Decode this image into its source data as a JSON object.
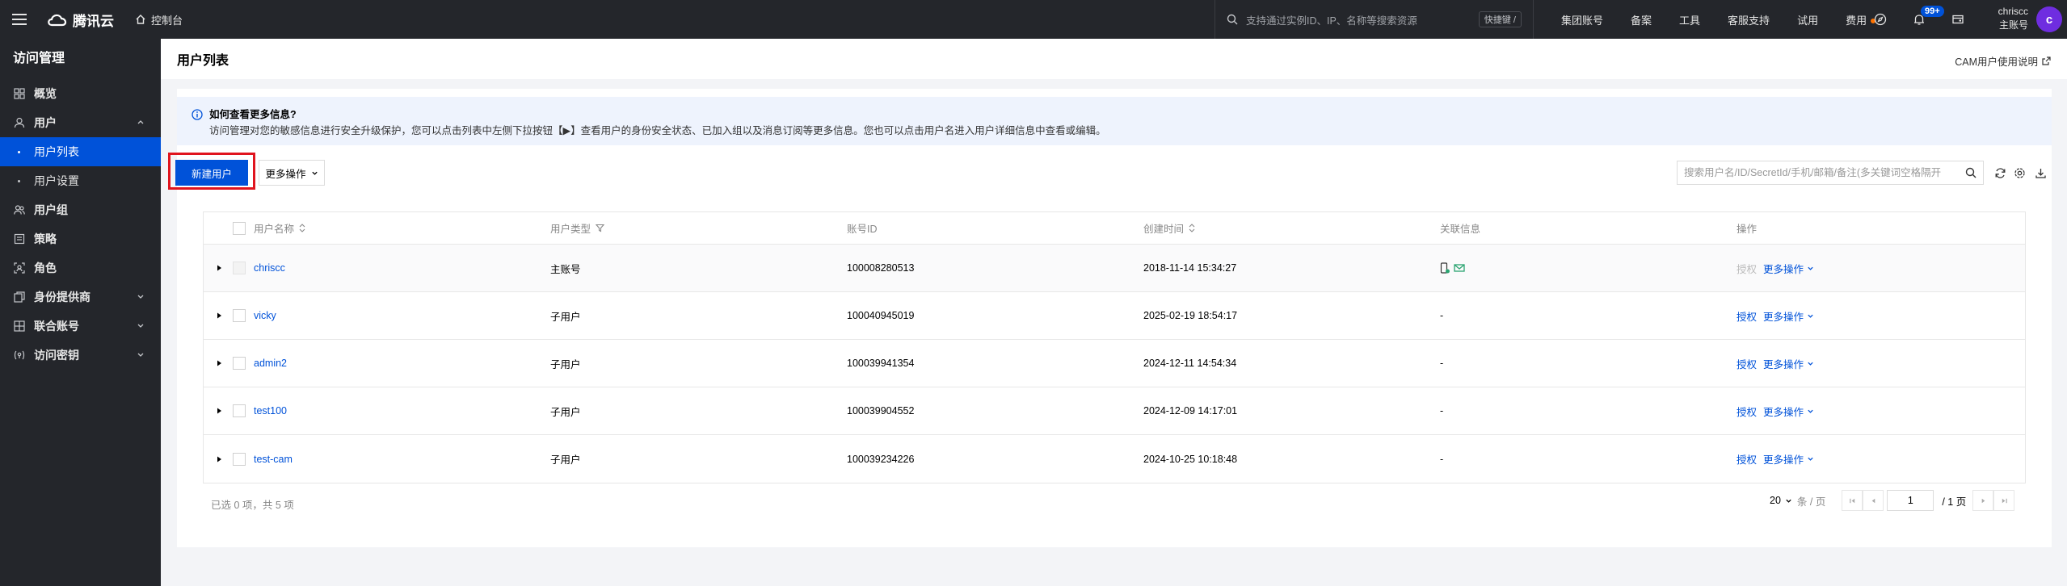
{
  "topbar": {
    "brand": "腾讯云",
    "console": "控制台",
    "search_placeholder": "支持通过实例ID、IP、名称等搜索资源",
    "shortcut": "快捷键 /",
    "links": [
      "集团账号",
      "备案",
      "工具",
      "客服支持",
      "试用",
      "费用"
    ],
    "notification_count": "99+",
    "user_name": "chriscc",
    "user_role": "主账号",
    "avatar_letter": "c"
  },
  "sidebar": {
    "title": "访问管理",
    "items": [
      {
        "label": "概览",
        "icon": "grid-icon"
      },
      {
        "label": "用户",
        "icon": "user-icon"
      },
      {
        "label": "用户列表",
        "sub": true,
        "active": true
      },
      {
        "label": "用户设置",
        "sub": true
      },
      {
        "label": "用户组",
        "icon": "group-icon"
      },
      {
        "label": "策略",
        "icon": "policy-icon"
      },
      {
        "label": "角色",
        "icon": "role-icon"
      },
      {
        "label": "身份提供商",
        "icon": "idp-icon"
      },
      {
        "label": "联合账号",
        "icon": "federated-icon"
      },
      {
        "label": "访问密钥",
        "icon": "key-icon"
      }
    ]
  },
  "header": {
    "title": "用户列表",
    "doc_link": "CAM用户使用说明"
  },
  "notice": {
    "title": "如何查看更多信息?",
    "body": "访问管理对您的敏感信息进行安全升级保护，您可以点击列表中左侧下拉按钮【▶】查看用户的身份安全状态、已加入组以及消息订阅等更多信息。您也可以点击用户名进入用户详细信息中查看或编辑。"
  },
  "toolbar": {
    "new_user": "新建用户",
    "more_actions": "更多操作",
    "search_placeholder": "搜索用户名/ID/SecretId/手机/邮箱/备注(多关键词空格隔开"
  },
  "table": {
    "columns": [
      "用户名称",
      "用户类型",
      "账号ID",
      "创建时间",
      "关联信息",
      "操作"
    ],
    "rows": [
      {
        "name": "chriscc",
        "type": "主账号",
        "id": "100008280513",
        "created": "2018-11-14 15:34:27",
        "assoc": "",
        "auth": "授权",
        "more": "更多操作"
      },
      {
        "name": "vicky",
        "type": "子用户",
        "id": "100040945019",
        "created": "2025-02-19 18:54:17",
        "assoc": "-",
        "auth": "授权",
        "more": "更多操作"
      },
      {
        "name": "admin2",
        "type": "子用户",
        "id": "100039941354",
        "created": "2024-12-11 14:54:34",
        "assoc": "-",
        "auth": "授权",
        "more": "更多操作"
      },
      {
        "name": "test100",
        "type": "子用户",
        "id": "100039904552",
        "created": "2024-12-09 14:17:01",
        "assoc": "-",
        "auth": "授权",
        "more": "更多操作"
      },
      {
        "name": "test-cam",
        "type": "子用户",
        "id": "100039234226",
        "created": "2024-10-25 10:18:48",
        "assoc": "-",
        "auth": "授权",
        "more": "更多操作"
      }
    ]
  },
  "footer": {
    "selected": "已选 0 项，共 5 项",
    "page_size": "20",
    "page_size_unit": "条 / 页",
    "current_page": "1",
    "total_pages": "/ 1 页"
  },
  "colors": {
    "primary": "#0052d9",
    "dark": "#24262b",
    "highlight": "#e0141e"
  }
}
